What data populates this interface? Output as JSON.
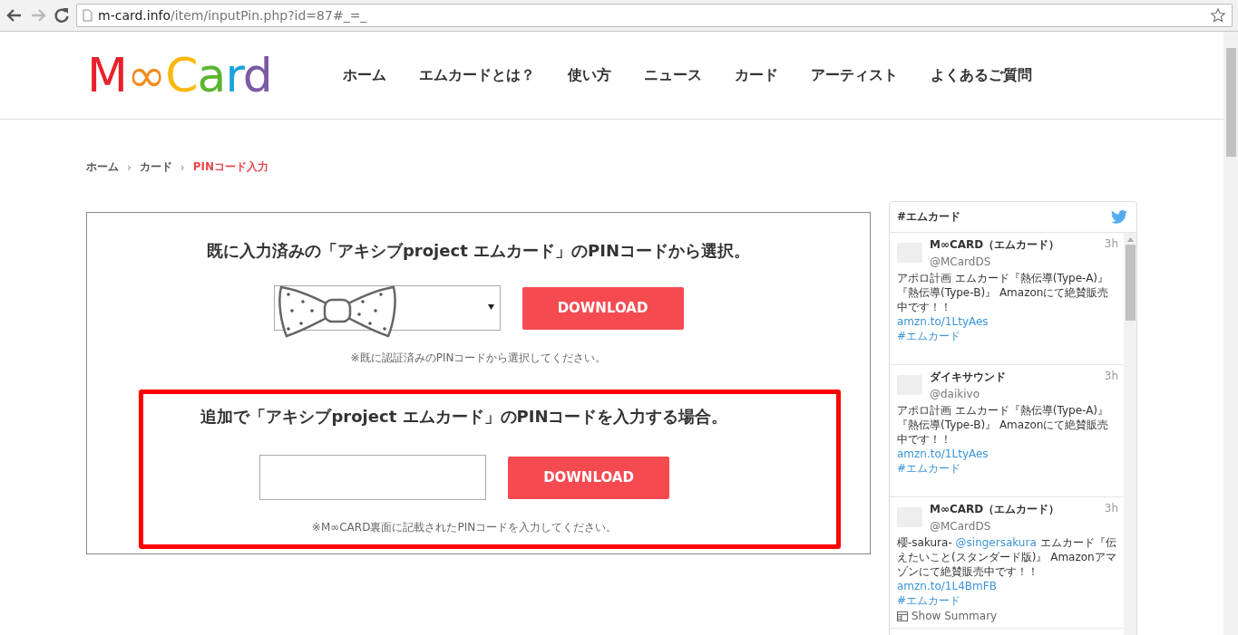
{
  "browser": {
    "url_host": "m-card.info",
    "url_path": "/item/inputPin.php?id=87#_=_"
  },
  "header": {
    "logo": "M∞Card",
    "nav": [
      "ホーム",
      "エムカードとは？",
      "使い方",
      "ニュース",
      "カード",
      "アーティスト",
      "よくあるご質問"
    ]
  },
  "breadcrumb": {
    "items": [
      {
        "label": "ホーム",
        "current": false
      },
      {
        "label": "カード",
        "current": false
      },
      {
        "label": "PINコード入力",
        "current": true
      }
    ],
    "separators": [
      "›",
      "›"
    ]
  },
  "select_section": {
    "heading": "既に入力済みの「アキシブproject エムカード」のPINコードから選択。",
    "button": "DOWNLOAD",
    "note": "※既に認証済みのPINコードから選択してください。"
  },
  "input_section": {
    "heading": "追加で「アキシブproject エムカード」のPINコードを入力する場合。",
    "button": "DOWNLOAD",
    "note": "※M∞CARD裏面に記載されたPINコードを入力してください。",
    "highlighted": true
  },
  "twitter": {
    "title": "#エムカード",
    "tweets": [
      {
        "name": "M∞CARD（エムカード）",
        "handle": "@MCardDS",
        "time": "3h",
        "body": [
          {
            "kind": "text",
            "text": "アポロ計画 エムカード『熱伝導(Type-A)』『熱伝導(Type-B)』 Amazonにて絶賛販売中です！！"
          }
        ],
        "link": "amzn.to/1LtyAes",
        "hashtag": "#エムカード"
      },
      {
        "name": "ダイキサウンド",
        "handle": "@daikivo",
        "time": "3h",
        "body": [
          {
            "kind": "text",
            "text": "アポロ計画 エムカード『熱伝導(Type-A)』『熱伝導(Type-B)』 Amazonにて絶賛販売中です！！"
          }
        ],
        "link": "amzn.to/1LtyAes",
        "hashtag": "#エムカード"
      },
      {
        "name": "M∞CARD（エムカード）",
        "handle": "@MCardDS",
        "time": "3h",
        "body": [
          {
            "kind": "text",
            "text": "櫻-sakura- "
          },
          {
            "kind": "mention",
            "text": "@singersakura"
          },
          {
            "kind": "text",
            "text": " エムカード『伝えたいこと(スタンダード版)』 Amazonアマゾンにて絶賛販売中です！！"
          }
        ],
        "link": "amzn.to/1L4BmFB",
        "hashtag": "#エムカード",
        "summary": "Show Summary"
      }
    ]
  }
}
